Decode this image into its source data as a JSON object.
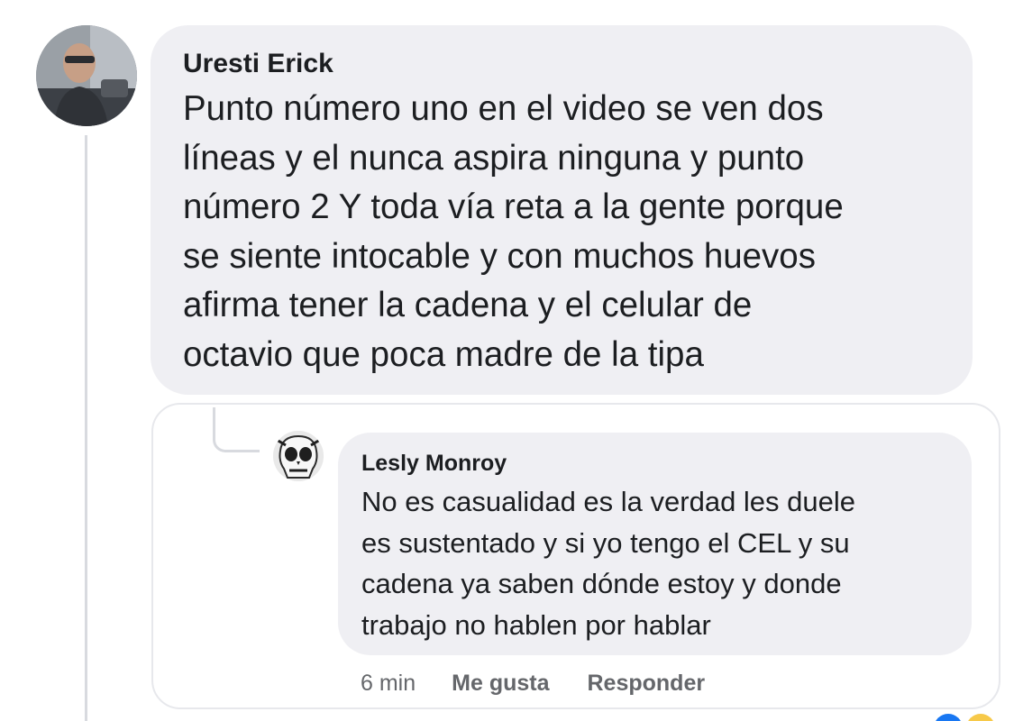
{
  "comment": {
    "author": "Uresti Erick",
    "text": "Punto número uno en el video se ven dos\nlíneas y el nunca aspira ninguna y punto\nnúmero 2 Y toda vía reta a la gente porque\nse siente intocable y con muchos huevos\nafirma tener la cadena y el celular de\noctavio que poca madre de la tipa"
  },
  "reply": {
    "author": "Lesly Monroy",
    "text": "No es casualidad es la verdad les duele\nes sustentado y si yo tengo el CEL y su\ncadena ya saben dónde estoy y donde\ntrabajo no hablen por hablar",
    "time": "6 min",
    "like_label": "Me gusta",
    "reply_label": "Responder"
  },
  "colors": {
    "bubble": "#efeff3",
    "text": "#1c1e21",
    "secondary_text": "#65676b",
    "thread_line": "#d8dadf"
  }
}
